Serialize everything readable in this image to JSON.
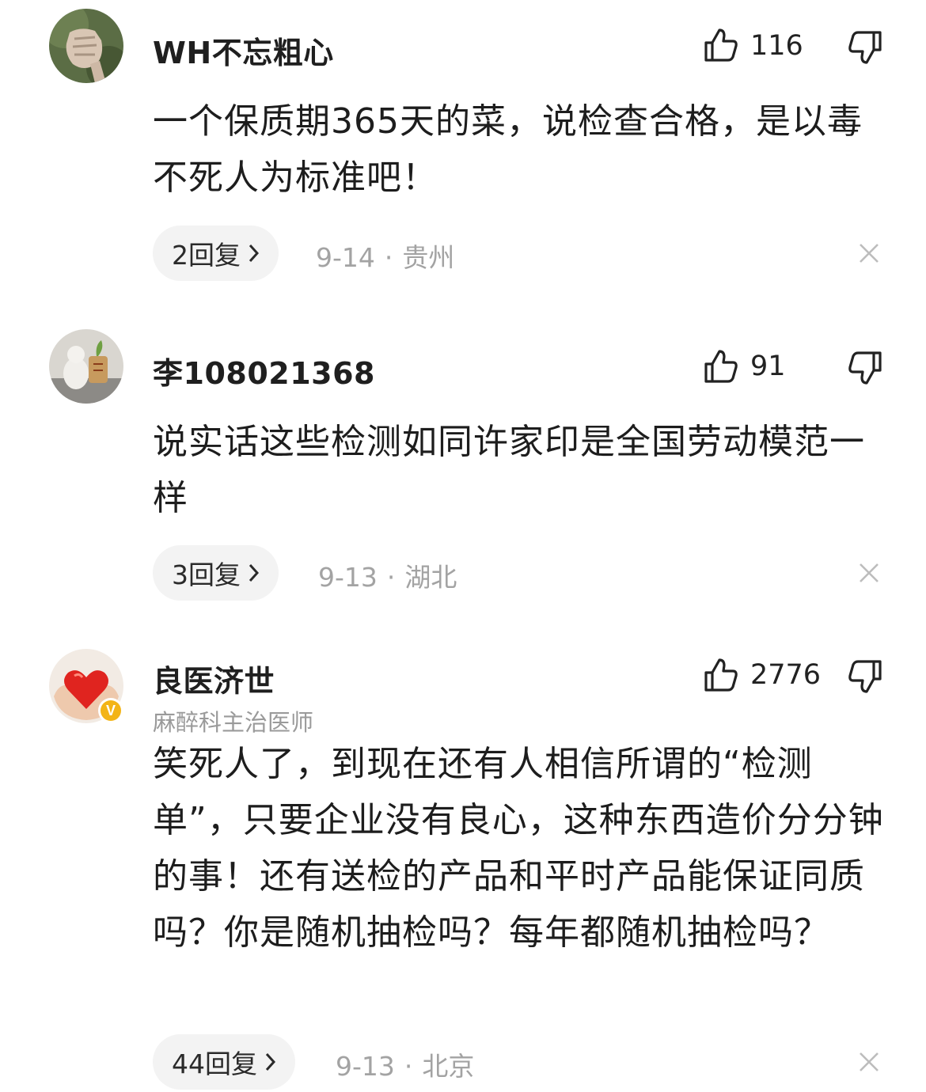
{
  "comments": [
    {
      "username": "WH不忘粗心",
      "likes": "116",
      "content": "一个保质期365天的菜，说检查合格，是以毒不死人为标准吧！",
      "replies": "2回复",
      "date": "9-14",
      "location": "贵州",
      "avatar_icon": "fist-photo-avatar"
    },
    {
      "username": "李108021368",
      "likes": "91",
      "content": "说实话这些检测如同许家印是全国劳动模范一样",
      "replies": "3回复",
      "date": "9-13",
      "location": "湖北",
      "avatar_icon": "figurine-photo-avatar"
    },
    {
      "username": "良医济世",
      "title": "麻醉科主治医师",
      "likes": "2776",
      "content": "笑死人了，到现在还有人相信所谓的“检测单”，只要企业没有良心，这种东西造价分分钟的事！还有送检的产品和平时产品能保证同质吗？你是随机抽检吗？每年都随机抽检吗？",
      "replies": "44回复",
      "date": "9-13",
      "location": "北京",
      "avatar_icon": "heart-in-hands-avatar",
      "verified_badge": "V"
    }
  ],
  "separator": "·",
  "colors": {
    "badge": "#f3b416",
    "pill": "#f3f3f3",
    "meta": "#a3a3a3"
  }
}
